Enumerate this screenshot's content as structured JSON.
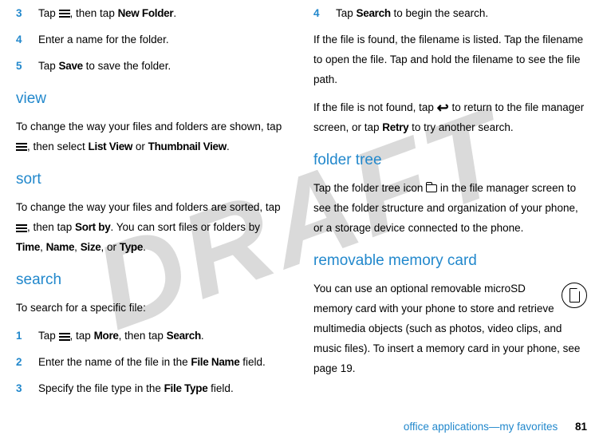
{
  "watermark": "DRAFT",
  "left": {
    "steps_top": [
      {
        "num": "3",
        "pre": "Tap ",
        "post": ", then tap ",
        "bold1": "New Folder",
        "tail": "."
      },
      {
        "num": "4",
        "text": "Enter a name for the folder."
      },
      {
        "num": "5",
        "pre": "Tap ",
        "bold1": "Save",
        "post": " to save the folder."
      }
    ],
    "view_heading": "view",
    "view_pre": "To change the way your files and folders are shown, tap ",
    "view_mid": ", then select ",
    "view_b1": "List View",
    "view_or": " or ",
    "view_b2": "Thumbnail View",
    "view_end": ".",
    "sort_heading": "sort",
    "sort_pre": "To change the way your files and folders are sorted, tap ",
    "sort_mid": ", then tap ",
    "sort_b1": "Sort by",
    "sort_post": ". You can sort files or folders by ",
    "sort_opts_1": "Time",
    "sort_c1": ", ",
    "sort_opts_2": "Name",
    "sort_c2": ", ",
    "sort_opts_3": "Size",
    "sort_c3": ", or ",
    "sort_opts_4": "Type",
    "sort_end": ".",
    "search_heading": "search",
    "search_intro": "To search for a specific file:",
    "search_steps": [
      {
        "num": "1",
        "pre": "Tap ",
        "mid": ", tap ",
        "b1": "More",
        "mid2": ", then tap ",
        "b2": "Search",
        "end": "."
      },
      {
        "num": "2",
        "pre": "Enter the name of the file in the ",
        "b1": "File Name",
        "end": " field."
      },
      {
        "num": "3",
        "pre": "Specify the file type in the ",
        "b1": "File Type",
        "end": " field."
      }
    ]
  },
  "right": {
    "step4_num": "4",
    "step4_pre": "Tap ",
    "step4_b": "Search",
    "step4_post": " to begin the search.",
    "found": "If the file is found, the filename is listed. Tap the filename to open the file. Tap and hold the filename to see the file path.",
    "notfound_pre": "If the file is not found, tap ",
    "notfound_mid": " to return to the file manager screen, or tap ",
    "notfound_b": "Retry",
    "notfound_end": " to try another search.",
    "folder_heading": "folder tree",
    "folder_pre": "Tap the folder tree icon ",
    "folder_post": " in the file manager screen to see the folder structure and organization of your phone, or a storage device connected to the phone.",
    "removable_heading": "removable memory card",
    "removable_text": "You can use an optional removable microSD memory card with your phone to store and retrieve multimedia objects (such as photos, video clips, and music files). To insert a memory card in your phone, see page 19."
  },
  "footer": {
    "text": "office applications—my favorites",
    "page": "81"
  }
}
